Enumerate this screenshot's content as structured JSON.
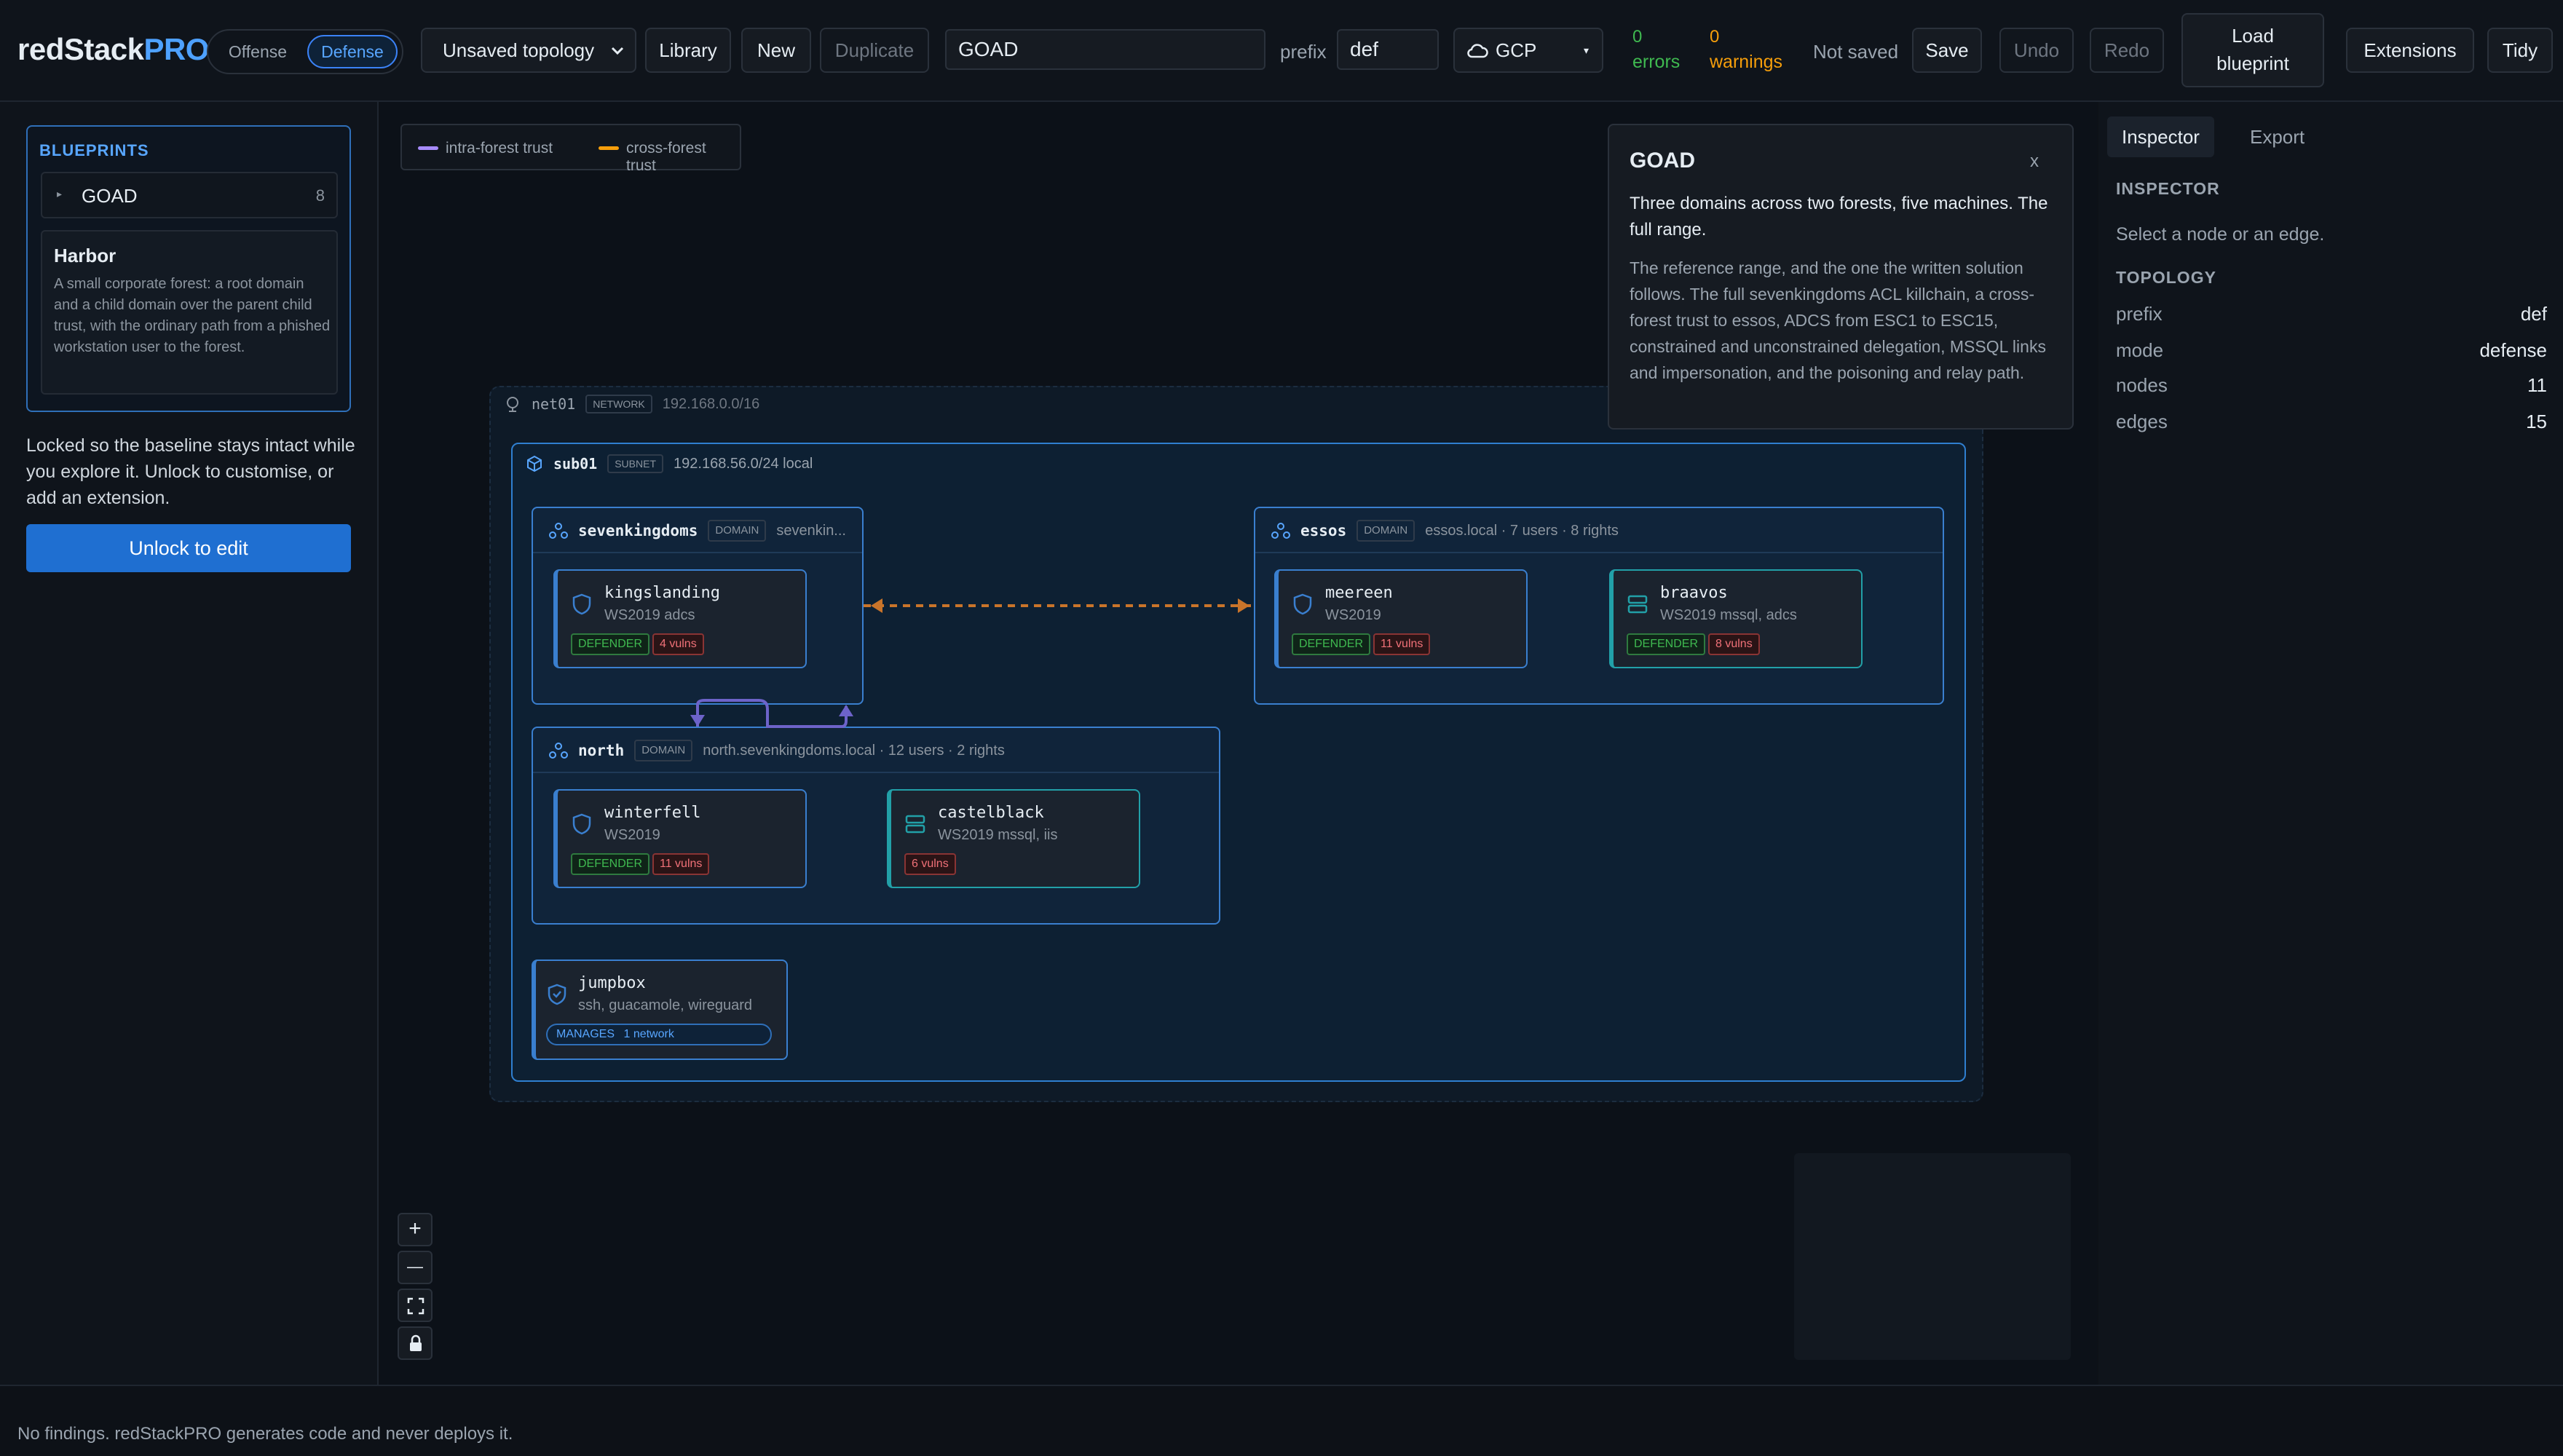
{
  "toolbar": {
    "logo_main": "redStack",
    "logo_accent": "PRO",
    "mode_offense": "Offense",
    "mode_defense": "Defense",
    "topology_select": "Unsaved topology",
    "library": "Library",
    "new": "New",
    "duplicate": "Duplicate",
    "name_value": "GOAD",
    "prefix_label": "prefix",
    "prefix_value": "def",
    "cloud_provider": "GCP",
    "errors_count": "0",
    "errors_label": "errors",
    "warnings_count": "0",
    "warnings_label": "warnings",
    "save_status": "Not saved",
    "save": "Save",
    "undo": "Undo",
    "redo": "Redo",
    "load_blueprint_1": "Load",
    "load_blueprint_2": "blueprint",
    "extensions": "Extensions",
    "tidy": "Tidy"
  },
  "blueprints": {
    "title": "BLUEPRINTS",
    "item_name": "GOAD",
    "item_count": "8",
    "card_title": "Harbor",
    "card_desc": "A small corporate forest: a root domain and a child domain over the parent child trust, with the ordinary path from a phished workstation user to the forest.",
    "lock_text": "Locked so the baseline stays intact while you explore it. Unlock to customise, or add an extension.",
    "unlock_button": "Unlock to edit"
  },
  "legend": {
    "intra": "intra-forest trust",
    "cross": "cross-forest trust"
  },
  "canvas": {
    "net_name": "net01",
    "net_tag": "NETWORK",
    "net_cidr": "192.168.0.0/16",
    "sub_name": "sub01",
    "sub_tag": "SUBNET",
    "sub_cidr": "192.168.56.0/24 local",
    "domain_tag": "DOMAIN",
    "domains": {
      "sevenkingdoms": {
        "name": "sevenkingdoms",
        "desc": "sevenkin..."
      },
      "essos": {
        "name": "essos",
        "desc": "essos.local · 7 users · 8 rights"
      },
      "north": {
        "name": "north",
        "desc": "north.sevenkingdoms.local · 12 users · 2 rights"
      }
    },
    "defender": "DEFENDER",
    "nodes": {
      "kingslanding": {
        "name": "kingslanding",
        "os": "WS2019 adcs",
        "vulns": "4 vulns"
      },
      "meereen": {
        "name": "meereen",
        "os": "WS2019",
        "vulns": "11 vulns"
      },
      "braavos": {
        "name": "braavos",
        "os": "WS2019 mssql, adcs",
        "vulns": "8 vulns"
      },
      "winterfell": {
        "name": "winterfell",
        "os": "WS2019",
        "vulns": "11 vulns"
      },
      "castelblack": {
        "name": "castelblack",
        "os": "WS2019 mssql, iis",
        "vulns": "6 vulns"
      },
      "jumpbox": {
        "name": "jumpbox",
        "os": "ssh, guacamole, wireguard",
        "manages_label": "MANAGES",
        "manages_value": "1 network"
      }
    }
  },
  "popover": {
    "title": "GOAD",
    "close": "x",
    "lead": "Three domains across two forests, five machines. The full range.",
    "body": "The reference range, and the one the written solution follows. The full sevenkingdoms ACL killchain, a cross-forest trust to essos, ADCS from ESC1 to ESC15, constrained and unconstrained delegation, MSSQL links and impersonation, and the poisoning and relay path."
  },
  "zoom_controls": {
    "zoom_in": "+",
    "zoom_out": "—"
  },
  "right_panel": {
    "tab_inspector": "Inspector",
    "tab_export": "Export",
    "inspector_title": "INSPECTOR",
    "inspector_hint": "Select a node or an edge.",
    "topology_title": "TOPOLOGY",
    "rows": [
      {
        "k": "prefix",
        "v": "def"
      },
      {
        "k": "mode",
        "v": "defense"
      },
      {
        "k": "nodes",
        "v": "11"
      },
      {
        "k": "edges",
        "v": "15"
      }
    ]
  },
  "status_bar": "No findings. redStackPRO generates code and never deploys it.",
  "colors": {
    "accent": "#3b82f6",
    "intra_trust": "#a78bfa",
    "cross_trust": "#f59e0b",
    "ok": "#3fb950",
    "warn": "#f59e0b"
  }
}
